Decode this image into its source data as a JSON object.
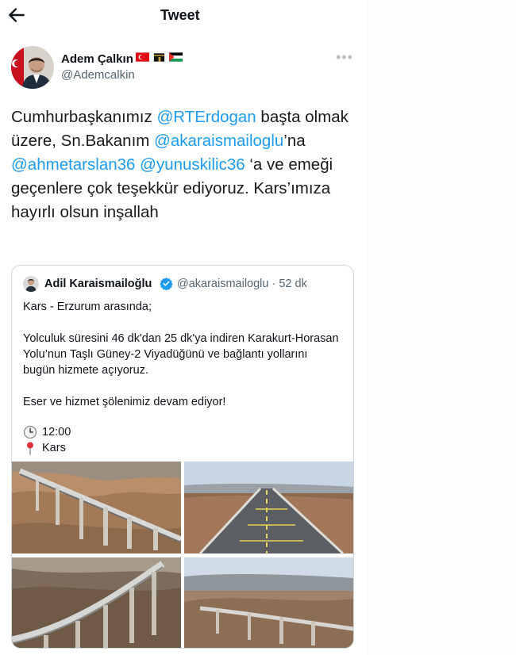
{
  "header": {
    "title": "Tweet",
    "back_icon": "arrow-left-icon"
  },
  "tweet": {
    "author": {
      "name": "Adem Çalkın",
      "handle": "@Ademcalkin",
      "flags": [
        "turkey-flag-icon",
        "kaaba-icon",
        "palestine-flag-icon"
      ]
    },
    "more_icon": "more-options-icon",
    "text_parts": [
      {
        "text": "Cumhurbaşkanımız ",
        "type": "text"
      },
      {
        "text": "@RTErdogan",
        "type": "mention"
      },
      {
        "text": " başta olmak üzere, Sn.Bakanım ",
        "type": "text"
      },
      {
        "text": "@akaraismailoglu",
        "type": "mention"
      },
      {
        "text": "’na ",
        "type": "text"
      },
      {
        "text": "@ahmetarslan36",
        "type": "mention"
      },
      {
        "text": " ",
        "type": "text"
      },
      {
        "text": "@yunuskilic36",
        "type": "mention"
      },
      {
        "text": " ‘a ve emeği geçenlere çok teşekkür ediyoruz. Kars’ımıza hayırlı olsun inşallah",
        "type": "text"
      }
    ]
  },
  "quote": {
    "author": {
      "name": "Adil Karaismailoğlu",
      "handle": "@akaraismailoglu · 52 dk",
      "verified": true
    },
    "text": "Kars - Erzurum arasında;\n\nYolculuk süresini 46 dk'dan 25 dk'ya indiren Karakurt-Horasan Yolu’nun Taşlı Güney-2 Viyadüğünü ve bağlantı yollarını bugün hizmete açıyoruz.\n\nEser ve hizmet şölenimiz devam ediyor!",
    "time": "12:00",
    "time_icon": "clock-icon",
    "location": "Kars",
    "location_icon": "pin-icon",
    "photos": [
      "viaduct-side-view",
      "highway-bridge-deck",
      "viaduct-aerial-curve",
      "viaduct-valley-wide"
    ]
  },
  "colors": {
    "accent": "#1d9bf0",
    "secondary_text": "#536471",
    "border": "#cfd9de"
  }
}
